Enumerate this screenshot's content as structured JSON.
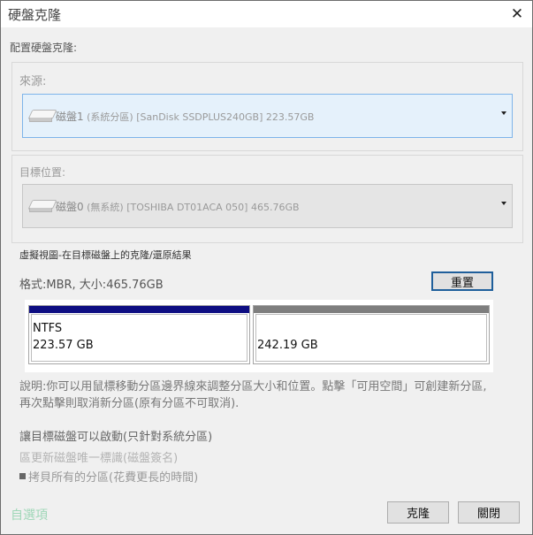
{
  "window": {
    "title": "硬盤克隆",
    "close_glyph": "✕"
  },
  "config_label": "配置硬盤克隆:",
  "source": {
    "label": "來源:",
    "disk_name": "磁盤1",
    "disk_details": "(系統分區) [SanDisk SSDPLUS240GB] 223.57GB"
  },
  "target": {
    "label": "目標位置:",
    "disk_name": "磁盤0",
    "disk_details": "(無系統) [TOSHIBA DT01ACA 050] 465.76GB"
  },
  "virtual_view": {
    "label": "虛擬視圖-在目標磁盤上的克隆/還原結果",
    "format_size": "格式:MBR, 大小:465.76GB",
    "reset_label": "重置",
    "partitions": [
      {
        "fs": "NTFS",
        "size": "223.57 GB",
        "bar_color": "#0d0d82"
      },
      {
        "fs": "",
        "size": "242.19 GB",
        "bar_color": "#7e7e7e"
      }
    ]
  },
  "description": "說明:你可以用鼠標移動分區邊界線來調整分區大小和位置。點擊「可用空間」可創建新分區,再次點擊則取消新分區(原有分區不可取消).",
  "options": {
    "bootable": "讓目標磁盤可以啟動(只針對系統分區)",
    "update_id": "區更新磁盤唯一標識(磁盤簽名)",
    "copy_all": "拷貝所有的分區(花費更長的時間)"
  },
  "advanced_link": "自選項",
  "buttons": {
    "clone": "克隆",
    "close": "關閉"
  }
}
